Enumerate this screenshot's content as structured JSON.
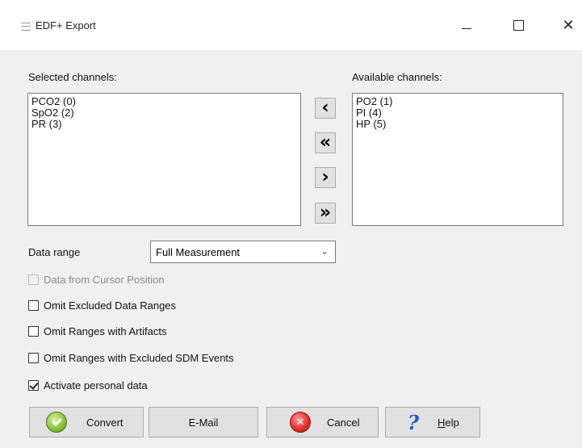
{
  "window": {
    "title": "EDF+ Export",
    "controls": {
      "minimize": "—",
      "maximize": "☐",
      "close": "✕"
    }
  },
  "selected": {
    "label": "Selected channels:",
    "items": [
      "PCO2 (0)",
      "SpO2 (2)",
      "PR (3)"
    ]
  },
  "available": {
    "label": "Available channels:",
    "items": [
      "PO2 (1)",
      "PI (4)",
      "HP (5)"
    ]
  },
  "arrows": {
    "add_one": "‹",
    "add_all": "«",
    "remove_one": "›",
    "remove_all": "»"
  },
  "data_range": {
    "label": "Data range",
    "value": "Full Measurement",
    "chevron": "⌄"
  },
  "options": [
    {
      "label": "Data from Cursor Position",
      "checked": false,
      "enabled": false
    },
    {
      "label": "Omit Excluded Data Ranges",
      "checked": false,
      "enabled": true
    },
    {
      "label": "Omit Ranges with Artifacts",
      "checked": false,
      "enabled": true
    },
    {
      "label": "Omit Ranges with Excluded SDM Events",
      "checked": false,
      "enabled": true
    },
    {
      "label": "Activate personal data",
      "checked": true,
      "enabled": true
    }
  ],
  "buttons": {
    "convert": "Convert",
    "email": "E-Mail",
    "cancel": "Cancel",
    "help_first": "H",
    "help_rest": "elp",
    "help_icon": "?",
    "cancel_icon": "✕"
  },
  "icons": {
    "app": "edf-export-icon",
    "convert": "green-check-icon",
    "cancel": "red-x-icon",
    "help": "blue-question-icon"
  },
  "colors": {
    "window_bg": "#f0f0f0",
    "titlebar_bg": "#ffffff",
    "button_bg": "#e1e1e1",
    "convert_icon": "#8cc63f",
    "cancel_icon": "#e0332f",
    "help_icon": "#1f5fbf"
  }
}
